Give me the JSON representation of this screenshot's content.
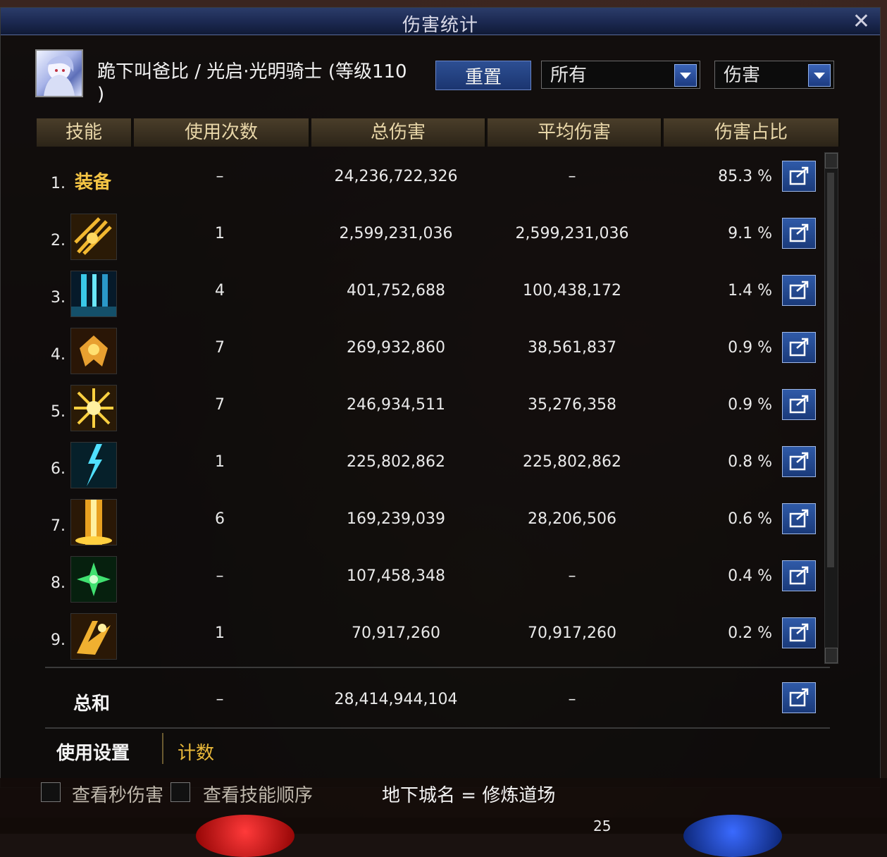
{
  "window": {
    "title": "伤害统计",
    "close_label": "✕"
  },
  "profile": {
    "name_line1": "跪下叫爸比 / 光启·光明骑士 (等级110",
    "name_line2": ")"
  },
  "controls": {
    "reset_label": "重置",
    "filter_target": "所有",
    "filter_type": "伤害"
  },
  "table": {
    "headers": [
      "技能",
      "使用次数",
      "总伤害",
      "平均伤害",
      "伤害占比"
    ],
    "rows": [
      {
        "idx": "1.",
        "name": "装备",
        "icon": "equipment-text",
        "uses": "–",
        "total": "24,236,722,326",
        "avg": "–",
        "pct": "85.3 %"
      },
      {
        "idx": "2.",
        "name": "",
        "icon": "gold-slash-skill-icon",
        "uses": "1",
        "total": "2,599,231,036",
        "avg": "2,599,231,036",
        "pct": "9.1 %"
      },
      {
        "idx": "3.",
        "name": "",
        "icon": "blue-pillar-skill-icon",
        "uses": "4",
        "total": "401,752,688",
        "avg": "100,438,172",
        "pct": "1.4 %"
      },
      {
        "idx": "4.",
        "name": "",
        "icon": "gold-wings-skill-icon",
        "uses": "7",
        "total": "269,932,860",
        "avg": "38,561,837",
        "pct": "0.9 %"
      },
      {
        "idx": "5.",
        "name": "",
        "icon": "light-burst-skill-icon",
        "uses": "7",
        "total": "246,934,511",
        "avg": "35,276,358",
        "pct": "0.9 %"
      },
      {
        "idx": "6.",
        "name": "",
        "icon": "lightning-skill-icon",
        "uses": "1",
        "total": "225,802,862",
        "avg": "225,802,862",
        "pct": "0.8 %"
      },
      {
        "idx": "7.",
        "name": "",
        "icon": "golden-beam-skill-icon",
        "uses": "6",
        "total": "169,239,039",
        "avg": "28,206,506",
        "pct": "0.6 %"
      },
      {
        "idx": "8.",
        "name": "",
        "icon": "green-star-skill-icon",
        "uses": "–",
        "total": "107,458,348",
        "avg": "–",
        "pct": "0.4 %"
      },
      {
        "idx": "9.",
        "name": "",
        "icon": "gold-strike-skill-icon",
        "uses": "1",
        "total": "70,917,260",
        "avg": "70,917,260",
        "pct": "0.2 %"
      }
    ],
    "total": {
      "label": "总和",
      "uses": "–",
      "total": "28,414,944,104",
      "avg": "–"
    }
  },
  "tabs": {
    "settings": "使用设置",
    "count": "计数"
  },
  "footer": {
    "per_second_label": "查看秒伤害",
    "skill_order_label": "查看技能顺序",
    "dungeon_label": "地下城名 = 修炼道场",
    "hotbar_number": "25"
  },
  "colors": {
    "accent_gold": "#f4c444",
    "title_blue": "#1b2850",
    "button_blue": "#2d4f93"
  }
}
